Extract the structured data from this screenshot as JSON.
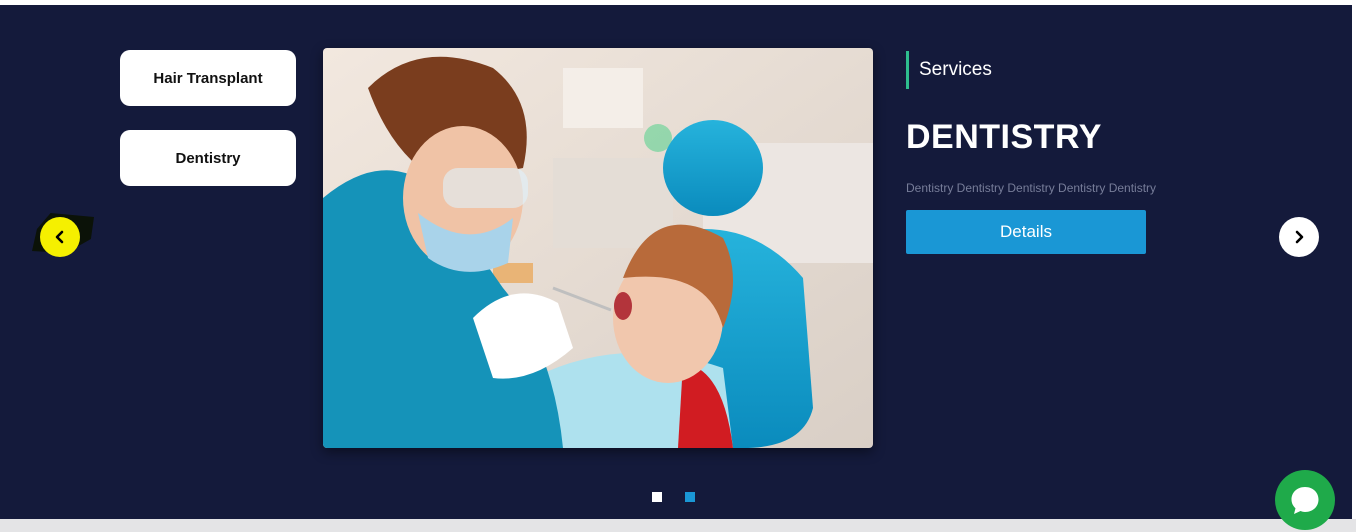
{
  "tabs": [
    {
      "label": "Hair Transplant"
    },
    {
      "label": "Dentistry"
    }
  ],
  "slide": {
    "kicker": "Services",
    "title": "DENTISTRY",
    "description": "Dentistry Dentistry Dentistry Dentistry Dentistry",
    "details_label": "Details",
    "image": "dentist-with-child-photo"
  },
  "nav": {
    "prev_icon": "chevron-left-icon",
    "next_icon": "chevron-right-icon"
  },
  "pagination": {
    "count": 2,
    "active_index": 2
  },
  "chat": {
    "icon": "chat-bubble-icon"
  },
  "colors": {
    "background": "#141a3b",
    "accent_blue": "#1a97d5",
    "accent_green": "#2ebd8e",
    "prev_arrow": "#f5f000",
    "chat_button": "#1faa4a"
  }
}
